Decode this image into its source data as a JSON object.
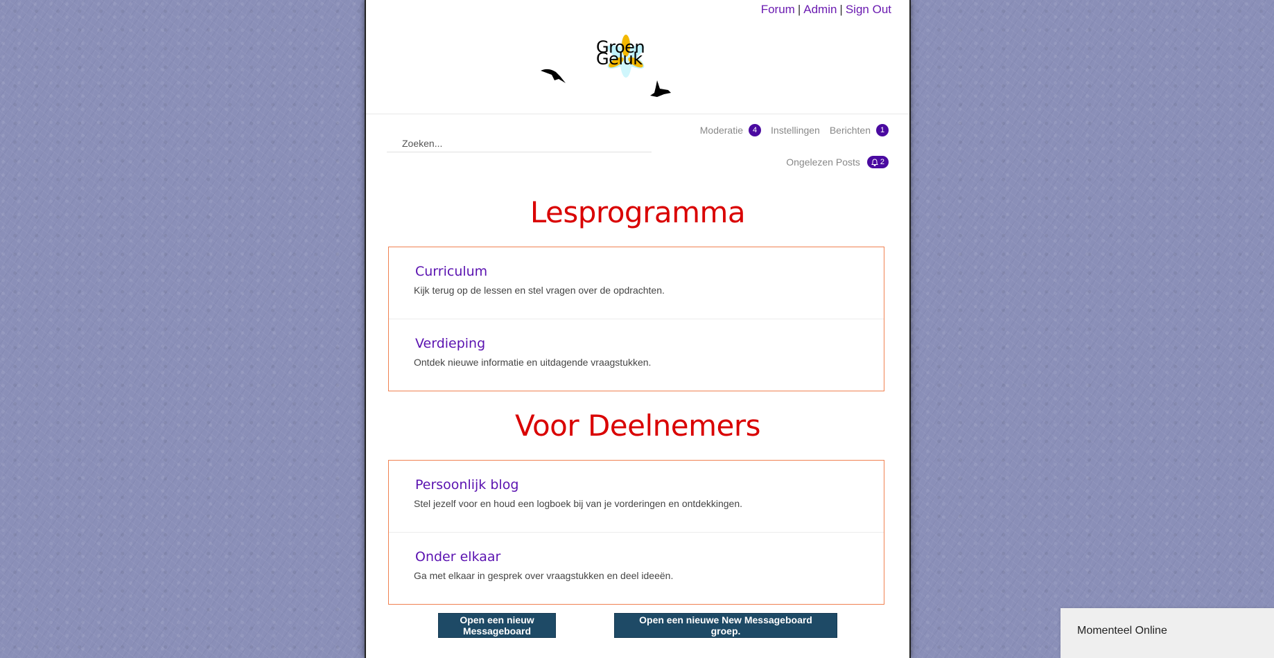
{
  "toplinks": {
    "forum": "Forum",
    "admin": "Admin",
    "signout": "Sign Out"
  },
  "logo": {
    "line1": "Groen",
    "line2": "Geluk"
  },
  "search": {
    "placeholder": "Zoeken..."
  },
  "nav": {
    "moderation": {
      "label": "Moderatie",
      "count": "4"
    },
    "settings": {
      "label": "Instellingen"
    },
    "messages": {
      "label": "Berichten",
      "count": "1"
    },
    "unread": {
      "label": "Ongelezen Posts",
      "count": "2"
    }
  },
  "sections": [
    {
      "title": "Lesprogramma",
      "items": [
        {
          "title": "Curriculum",
          "desc": "Kijk terug op de lessen en stel vragen over de opdrachten."
        },
        {
          "title": "Verdieping",
          "desc": "Ontdek nieuwe informatie en uitdagende vraagstukken."
        }
      ]
    },
    {
      "title": "Voor Deelnemers",
      "items": [
        {
          "title": "Persoonlijk blog",
          "desc": "Stel jezelf voor en houd een logboek bij van je vorderingen en ontdekkingen."
        },
        {
          "title": "Onder elkaar",
          "desc": "Ga met elkaar in gesprek over vraagstukken en deel ideeën."
        }
      ]
    }
  ],
  "buttons": {
    "new_board": "Open een nieuw Messageboard",
    "new_group": "Open een nieuwe New Messageboard groep."
  },
  "online": {
    "label": "Momenteel Online"
  },
  "colors": {
    "accent": "#4a0aa0",
    "heading": "#d90000",
    "border": "#f08050",
    "button": "#1e4a66"
  }
}
